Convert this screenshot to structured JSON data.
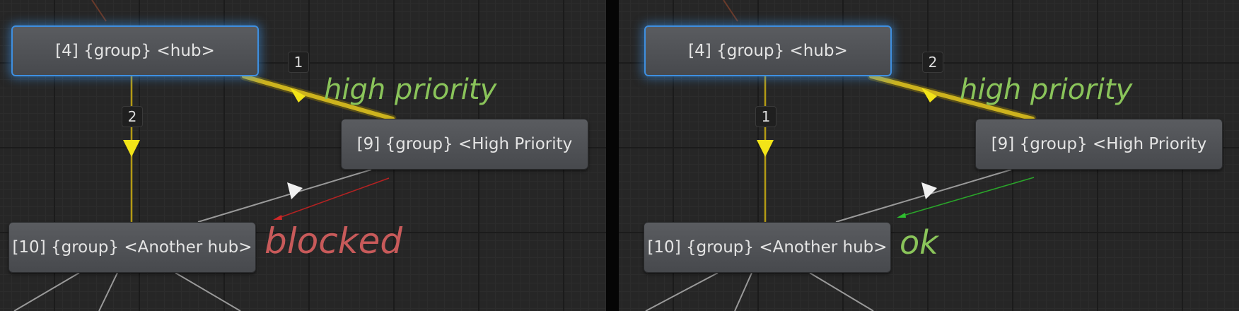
{
  "colors": {
    "canvas": "#262626",
    "node_fill": "#505256",
    "selected_border": "#3e8fe0",
    "priority_edge": "#bfa41a",
    "arrow_yellow": "#f2e418",
    "edge_gray": "#8a8a8a",
    "blocked_red": "#c85a5a",
    "ok_green": "#8ac45a"
  },
  "left_panel": {
    "hub_node": "[4] {group} <hub>",
    "priority_node": "[9] {group} <High Priority",
    "another_hub_node": "[10] {group} <Another hub>",
    "priority_edge_order": "1",
    "down_edge_order": "2",
    "edge_label": "high priority",
    "status_label": "blocked",
    "status_color": "red"
  },
  "right_panel": {
    "hub_node": "[4] {group} <hub>",
    "priority_node": "[9] {group} <High Priority",
    "another_hub_node": "[10] {group} <Another hub>",
    "priority_edge_order": "2",
    "down_edge_order": "1",
    "edge_label": "high priority",
    "status_label": "ok",
    "status_color": "green"
  }
}
